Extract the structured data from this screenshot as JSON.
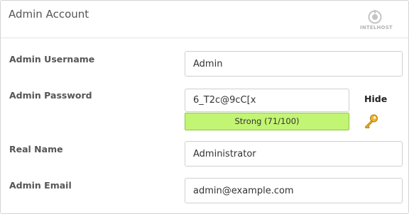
{
  "header": {
    "title": "Admin Account",
    "logo_text": "INTELHOST"
  },
  "form": {
    "username": {
      "label": "Admin Username",
      "value": "Admin"
    },
    "password": {
      "label": "Admin Password",
      "value": "6_T2c@9cC[x",
      "toggle_label": "Hide",
      "strength_text": "Strong (71/100)",
      "strength_score": 71,
      "strength_color": "#c2f573"
    },
    "real_name": {
      "label": "Real Name",
      "value": "Administrator"
    },
    "email": {
      "label": "Admin Email",
      "value": "admin@example.com"
    }
  },
  "icons": {
    "logo": "intelhost-logo-icon",
    "password_tool": "key-icon"
  }
}
